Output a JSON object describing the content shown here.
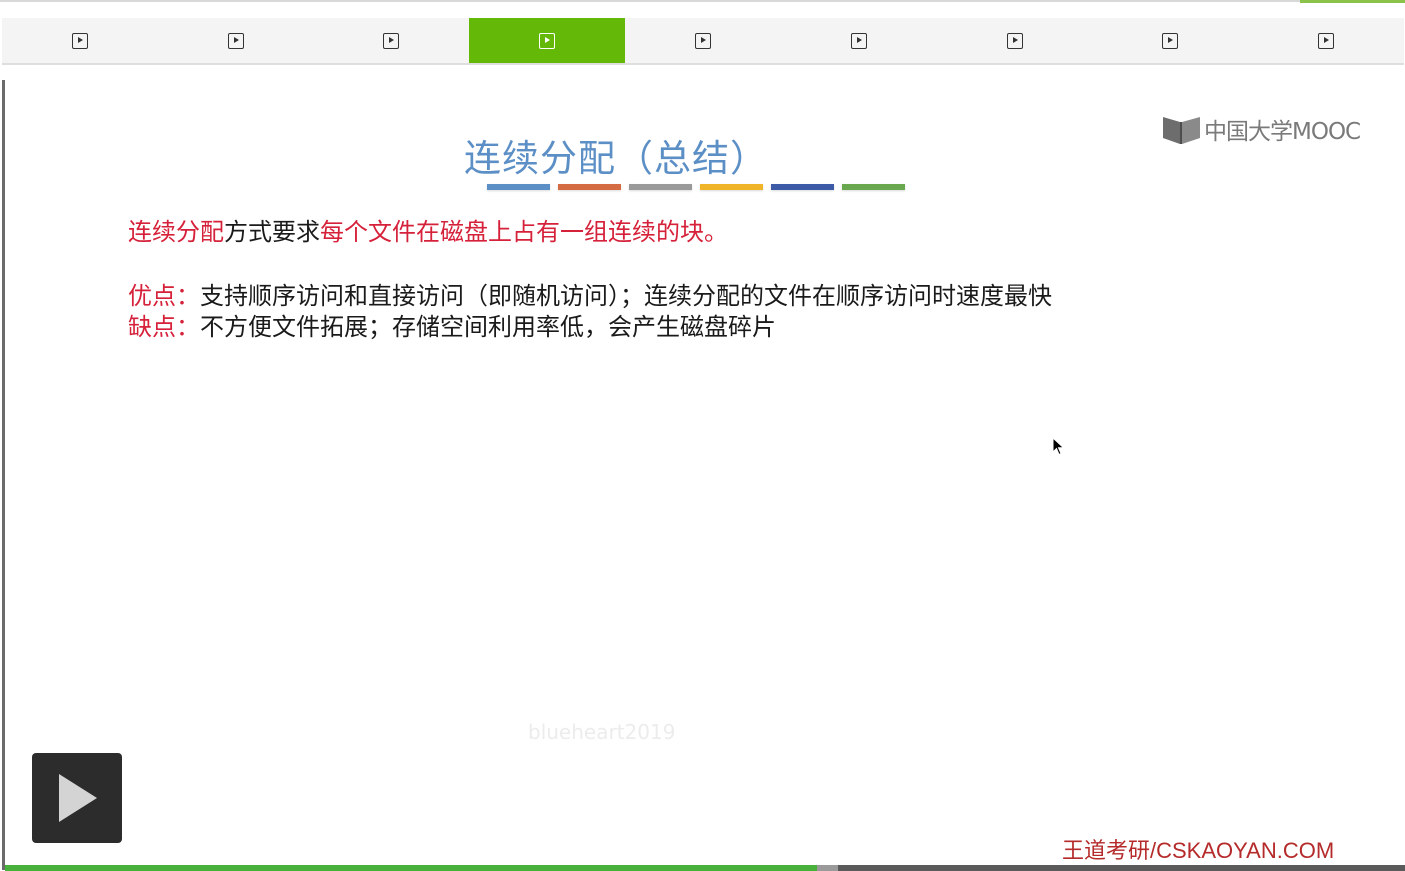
{
  "tabs": [
    {
      "icon": "play-square-icon",
      "active": false
    },
    {
      "icon": "play-square-icon",
      "active": false
    },
    {
      "icon": "play-square-icon",
      "active": false
    },
    {
      "icon": "play-square-icon",
      "active": true
    },
    {
      "icon": "play-square-icon",
      "active": false
    },
    {
      "icon": "play-square-icon",
      "active": false
    },
    {
      "icon": "play-square-icon",
      "active": false
    },
    {
      "icon": "play-square-icon",
      "active": false
    },
    {
      "icon": "play-square-icon",
      "active": false
    }
  ],
  "slide": {
    "title": "连续分配（总结）",
    "title_bar_colors": [
      "#5b8fc6",
      "#d46b43",
      "#9a9a9a",
      "#f0b429",
      "#3c5aa6",
      "#6aa84f"
    ],
    "logo_text": "中国大学MOOC",
    "line1": {
      "red1": "连续分配",
      "black1": "方式要求",
      "red2": "每个文件在磁盘上占有一组连续的块。"
    },
    "line2": {
      "label": "优点：",
      "text": "支持顺序访问和直接访问（即随机访问）；连续分配的文件在顺序访问时速度最快"
    },
    "line3": {
      "label": "缺点：",
      "text": "不方便文件拓展；存储空间利用率低，会产生磁盘碎片"
    },
    "watermark": "blueheart2019",
    "brand": "王道考研/CSKAOYAN.COM"
  },
  "player": {
    "play_icon": "play-icon",
    "progress_fraction": 0.58,
    "buffer_fraction": 0.595
  },
  "colors": {
    "active_tab": "#64b808",
    "title": "#5b8fc6",
    "highlight_red": "#d6213a",
    "brand": "#b52a2a"
  }
}
